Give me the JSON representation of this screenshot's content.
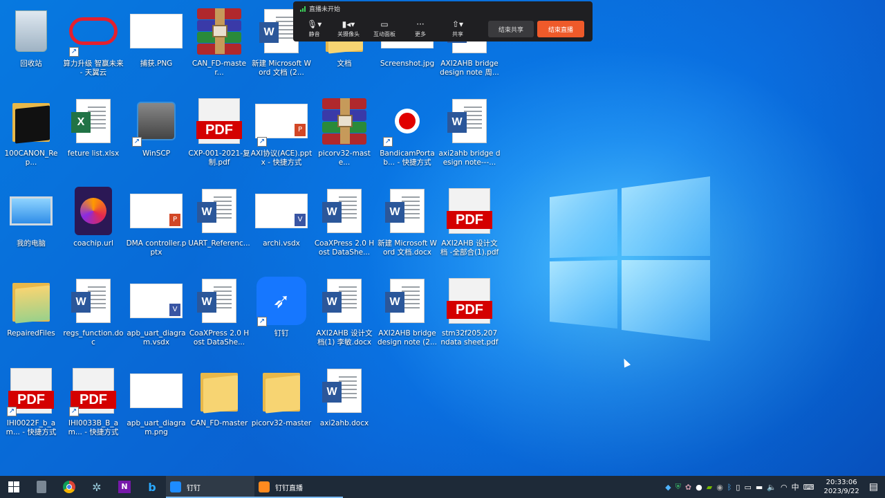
{
  "live_bar": {
    "status": "直播未开始",
    "tools": [
      {
        "name": "mute",
        "label": "静音",
        "icon": "microphone-icon"
      },
      {
        "name": "camera",
        "label": "关摄像头",
        "icon": "camera-icon"
      },
      {
        "name": "interact",
        "label": "互动面板",
        "icon": "chat-icon"
      },
      {
        "name": "more",
        "label": "更多",
        "icon": "more-dots-icon"
      },
      {
        "name": "share",
        "label": "共享",
        "icon": "share-upload-icon"
      }
    ],
    "end_share_label": "结束共享",
    "end_live_label": "结束直播"
  },
  "desktop_icons": [
    {
      "label": "回收站",
      "type": "recycle"
    },
    {
      "label": "算力升级 智赢未来 - 天翼云",
      "type": "cloud",
      "shortcut": true
    },
    {
      "label": "捕获.PNG",
      "type": "image"
    },
    {
      "label": "CAN_FD-master...",
      "type": "rar"
    },
    {
      "label": "新建 Microsoft Word 文档 (2...",
      "type": "word"
    },
    {
      "label": "文档",
      "type": "folder"
    },
    {
      "label": "Screenshot.jpg",
      "type": "image"
    },
    {
      "label": "AXI2AHB bridge design note 周...",
      "type": "word"
    },
    {
      "label": "100CANON_Rep...",
      "type": "folder-dark"
    },
    {
      "label": "feture list.xlsx",
      "type": "excel"
    },
    {
      "label": "WinSCP",
      "type": "winscp",
      "shortcut": true
    },
    {
      "label": "CXP-001-2021-复制.pdf",
      "type": "pdf"
    },
    {
      "label": "AXI协议(ACE).pptx - 快捷方式",
      "type": "ppt-thumb",
      "shortcut": true
    },
    {
      "label": "picorv32-maste...",
      "type": "rar"
    },
    {
      "label": "BandicamPortab... - 快捷方式",
      "type": "bandicam",
      "shortcut": true
    },
    {
      "label": "axi2ahb bridge design note---...",
      "type": "word"
    },
    {
      "label": "我的电脑",
      "type": "computer"
    },
    {
      "label": "coachip.url",
      "type": "firefox"
    },
    {
      "label": "DMA controller.pptx",
      "type": "ppt-thumb"
    },
    {
      "label": "UART_Referenc...",
      "type": "word"
    },
    {
      "label": "archi.vsdx",
      "type": "visio"
    },
    {
      "label": "CoaXPress 2.0 Host DataShe...",
      "type": "word"
    },
    {
      "label": "新建 Microsoft Word 文档.docx",
      "type": "word"
    },
    {
      "label": "AXI2AHB 设计文档 -全部合(1).pdf",
      "type": "pdf"
    },
    {
      "label": "RepairedFiles",
      "type": "folder-green"
    },
    {
      "label": "regs_function.doc",
      "type": "word"
    },
    {
      "label": "apb_uart_diagram.vsdx",
      "type": "visio"
    },
    {
      "label": "CoaXPress 2.0 Host DataShe...",
      "type": "word"
    },
    {
      "label": "钉钉",
      "type": "dingtalk",
      "shortcut": true
    },
    {
      "label": "AXI2AHB 设计文档(1) 李敏.docx",
      "type": "word"
    },
    {
      "label": "AXI2AHB bridge design note (2...",
      "type": "word"
    },
    {
      "label": "stm32f205,207 ndata sheet.pdf",
      "type": "pdf"
    },
    {
      "label": "IHI0022F_b_am... - 快捷方式",
      "type": "pdf",
      "shortcut": true
    },
    {
      "label": "IHI0033B_B_am... - 快捷方式",
      "type": "pdf",
      "shortcut": true
    },
    {
      "label": "apb_uart_diagram.png",
      "type": "image"
    },
    {
      "label": "CAN_FD-master",
      "type": "folder"
    },
    {
      "label": "picorv32-master",
      "type": "folder"
    },
    {
      "label": "axi2ahb.docx",
      "type": "word"
    }
  ],
  "taskbar": {
    "apps": [
      {
        "label": "钉钉",
        "icon": "dingtalk-icon"
      },
      {
        "label": "钉钉直播",
        "icon": "dingtalk-live-icon"
      }
    ],
    "ime": "中",
    "time": "20:33:06",
    "date": "2023/9/22"
  }
}
